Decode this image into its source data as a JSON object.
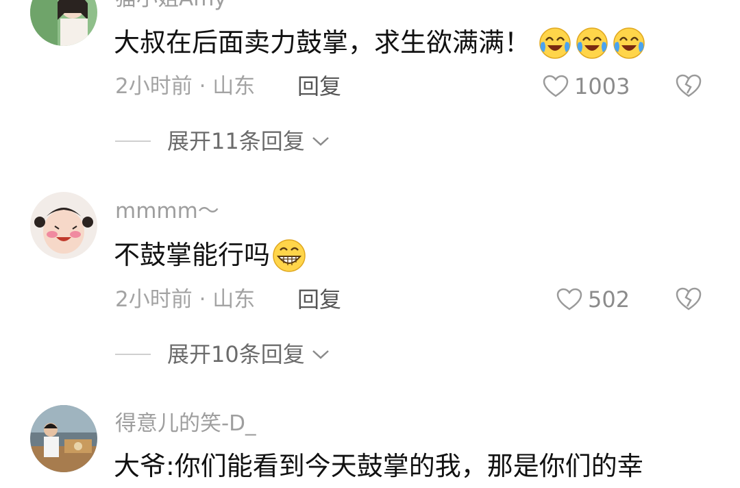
{
  "comments": [
    {
      "username": "猫小姐Amy",
      "text": "大叔在后面卖力鼓掌，求生欲满满！",
      "emojis": [
        "crying-laughing-emoji",
        "crying-laughing-emoji",
        "crying-laughing-emoji"
      ],
      "meta": "2小时前 · 山东",
      "reply_label": "回复",
      "likes": "1003",
      "expand_label": "展开11条回复"
    },
    {
      "username": "mmmm～",
      "text": "不鼓掌能行吗",
      "emojis": [
        "grin-emoji"
      ],
      "meta": "2小时前 · 山东",
      "reply_label": "回复",
      "likes": "502",
      "expand_label": "展开10条回复"
    },
    {
      "username": "得意儿的笑-D_",
      "text": "大爷:你们能看到今天鼓掌的我，那是你们的幸"
    }
  ],
  "colors": {
    "meta": "#a3a3a3",
    "emoji_face": "#ffd54a",
    "tear": "#4aa3ef"
  }
}
